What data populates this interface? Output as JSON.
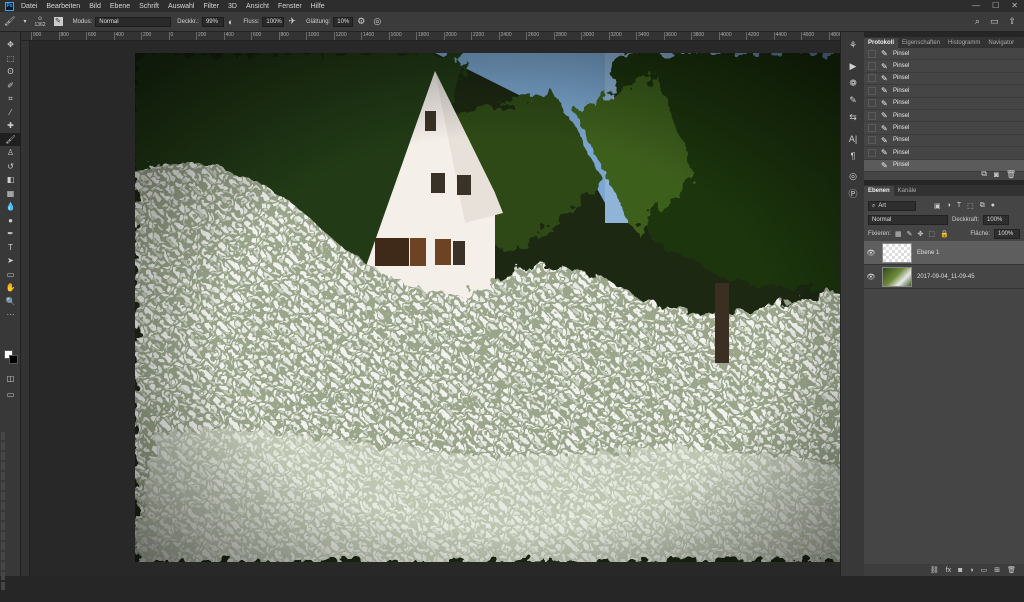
{
  "app": {
    "logo": "Ps"
  },
  "menu": [
    "Datei",
    "Bearbeiten",
    "Bild",
    "Ebene",
    "Schrift",
    "Auswahl",
    "Filter",
    "3D",
    "Ansicht",
    "Fenster",
    "Hilfe"
  ],
  "options": {
    "brush_size": "1362",
    "modus_label": "Modus:",
    "modus_value": "Normal",
    "deckkraft_label": "Deckkr.:",
    "deckkraft_value": "99%",
    "fluss_label": "Fluss:",
    "fluss_value": "100%",
    "glaettung_label": "Glättung:",
    "glaettung_value": "10%"
  },
  "ruler_ticks": [
    "900",
    "800",
    "600",
    "400",
    "200",
    "0",
    "200",
    "400",
    "600",
    "800",
    "1000",
    "1200",
    "1400",
    "1600",
    "1800",
    "2000",
    "2200",
    "2400",
    "2600",
    "2800",
    "3000",
    "3200",
    "3400",
    "3600",
    "3800",
    "4000",
    "4200",
    "4400",
    "4600",
    "4800"
  ],
  "history": {
    "tabs": [
      "Protokoll",
      "Eigenschaften",
      "Histogramm",
      "Navigator"
    ],
    "items": [
      "Pinsel",
      "Pinsel",
      "Pinsel",
      "Pinsel",
      "Pinsel",
      "Pinsel",
      "Pinsel",
      "Pinsel",
      "Pinsel",
      "Pinsel"
    ]
  },
  "layers": {
    "tabs": [
      "Ebenen",
      "Kanäle"
    ],
    "filter_value": "Art",
    "blend_mode": "Normal",
    "opacity_label": "Deckkraft:",
    "opacity_value": "100%",
    "lock_label": "Fixieren:",
    "fill_label": "Fläche:",
    "fill_value": "100%",
    "items": [
      {
        "name": "Ebene 1",
        "selected": true
      },
      {
        "name": "2017-09-04_11-09-45",
        "selected": false
      }
    ]
  },
  "icons": {
    "tools": [
      "move-icon",
      "marquee-icon",
      "lasso-icon",
      "quick-select-icon",
      "crop-icon",
      "eyedropper-icon",
      "healing-icon",
      "brush-icon",
      "stamp-icon",
      "history-brush-icon",
      "eraser-icon",
      "gradient-icon",
      "blur-icon",
      "dodge-icon",
      "pen-icon",
      "type-icon",
      "path-select-icon",
      "shape-icon",
      "hand-icon",
      "zoom-icon",
      "more-tools-icon"
    ]
  },
  "colors": {
    "accent": "#31a8ff",
    "foreground": "#ffffff",
    "background": "#000000"
  }
}
